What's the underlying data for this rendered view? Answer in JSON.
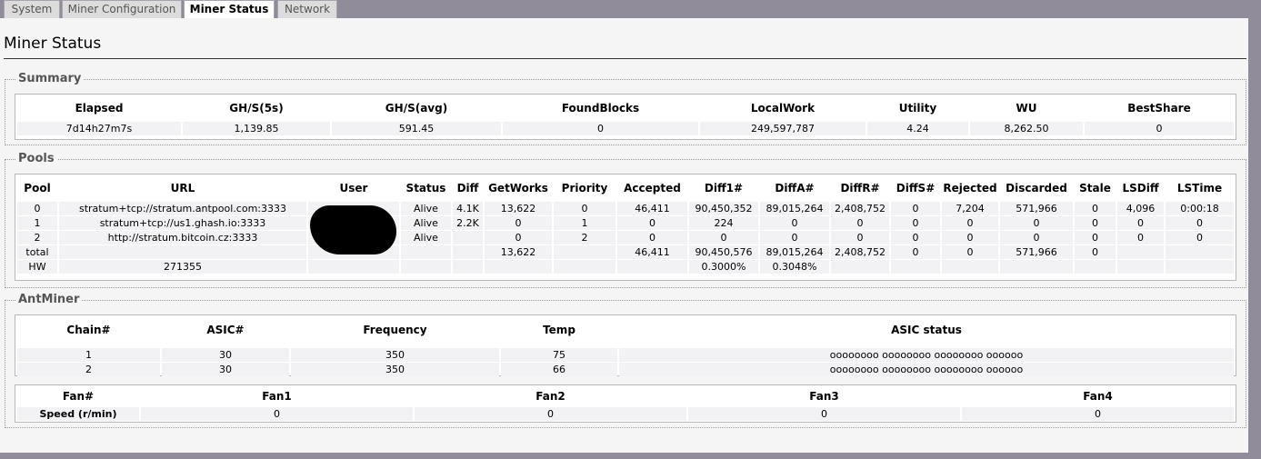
{
  "tabs": [
    {
      "label": "System"
    },
    {
      "label": "Miner Configuration"
    },
    {
      "label": "Miner Status",
      "active": true
    },
    {
      "label": "Network"
    }
  ],
  "page_title": "Miner Status",
  "summary": {
    "legend": "Summary",
    "headers": [
      "Elapsed",
      "GH/S(5s)",
      "GH/S(avg)",
      "FoundBlocks",
      "LocalWork",
      "Utility",
      "WU",
      "BestShare"
    ],
    "row": [
      "7d14h27m7s",
      "1,139.85",
      "591.45",
      "0",
      "249,597,787",
      "4.24",
      "8,262.50",
      "0"
    ]
  },
  "pools": {
    "legend": "Pools",
    "headers": [
      "Pool",
      "URL",
      "User",
      "Status",
      "Diff",
      "GetWorks",
      "Priority",
      "Accepted",
      "Diff1#",
      "DiffA#",
      "DiffR#",
      "DiffS#",
      "Rejected",
      "Discarded",
      "Stale",
      "LSDiff",
      "LSTime"
    ],
    "rows": [
      [
        "0",
        "stratum+tcp://stratum.antpool.com:3333",
        "",
        "Alive",
        "4.1K",
        "13,622",
        "0",
        "46,411",
        "90,450,352",
        "89,015,264",
        "2,408,752",
        "0",
        "7,204",
        "571,966",
        "0",
        "4,096",
        "0:00:18"
      ],
      [
        "1",
        "stratum+tcp://us1.ghash.io:3333",
        "",
        "Alive",
        "2.2K",
        "0",
        "1",
        "0",
        "224",
        "0",
        "0",
        "0",
        "0",
        "0",
        "0",
        "0",
        "0"
      ],
      [
        "2",
        "http://stratum.bitcoin.cz:3333",
        "",
        "Alive",
        "",
        "0",
        "2",
        "0",
        "0",
        "0",
        "0",
        "0",
        "0",
        "0",
        "0",
        "0",
        "0"
      ],
      [
        "total",
        "",
        "",
        "",
        "",
        "13,622",
        "",
        "46,411",
        "90,450,576",
        "89,015,264",
        "2,408,752",
        "0",
        "0",
        "571,966",
        "0",
        "",
        ""
      ],
      [
        "HW",
        "271355",
        "",
        "",
        "",
        "",
        "",
        "",
        "0.3000%",
        "0.3048%",
        "",
        "",
        "",
        "",
        "",
        "",
        ""
      ]
    ]
  },
  "antminer": {
    "legend": "AntMiner",
    "chain_headers": [
      "Chain#",
      "ASIC#",
      "Frequency",
      "Temp",
      "ASIC status"
    ],
    "chain_rows": [
      [
        "1",
        "30",
        "350",
        "75",
        "oooooooo oooooooo oooooooo oooooo"
      ],
      [
        "2",
        "30",
        "350",
        "66",
        "oooooooo oooooooo oooooooo oooooo"
      ]
    ],
    "fan_headers": [
      "Fan#",
      "Fan1",
      "Fan2",
      "Fan3",
      "Fan4"
    ],
    "fan_row": [
      "Speed (r/min)",
      "0",
      "0",
      "0",
      "0"
    ]
  },
  "colors": {
    "frame": "#908c99",
    "content_bg": "#f5f5f5",
    "cell_bg": "#f2f2f4"
  }
}
